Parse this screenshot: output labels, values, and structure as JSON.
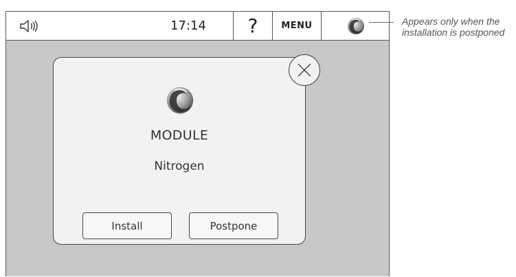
{
  "topbar": {
    "speaker_icon": "speaker-volume-icon",
    "time": "17:14",
    "help_label": "?",
    "menu_label": "MENU",
    "module_icon": "module-swirl-icon"
  },
  "dialog": {
    "icon": "module-swirl-icon",
    "title": "MODULE",
    "subtitle": "Nitrogen",
    "close_icon": "close-circle-icon",
    "install_label": "Install",
    "postpone_label": "Postpone"
  },
  "annotation": {
    "text": "Appears only when the installation is postponed"
  }
}
